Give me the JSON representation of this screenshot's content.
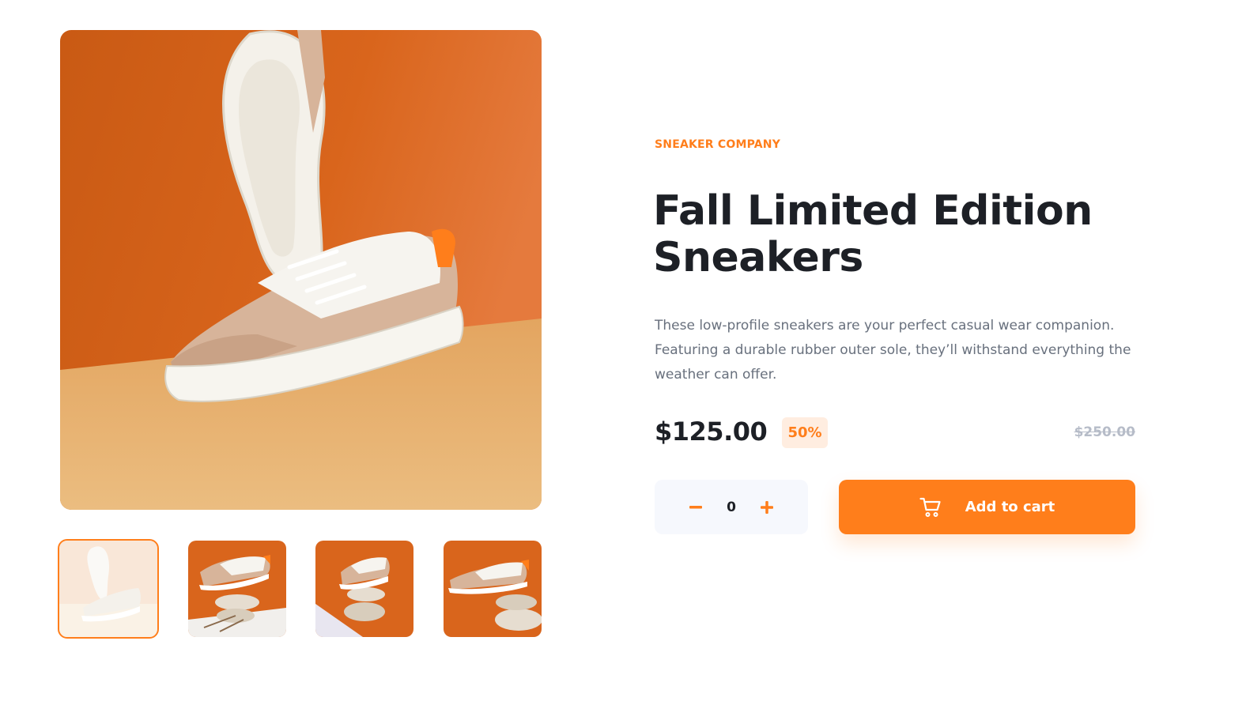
{
  "gallery": {
    "main_image_alt": "Fall Limited Edition Sneakers",
    "thumbnails": [
      {
        "alt": "Product thumbnail 1",
        "active": true
      },
      {
        "alt": "Product thumbnail 2",
        "active": false
      },
      {
        "alt": "Product thumbnail 3",
        "active": false
      },
      {
        "alt": "Product thumbnail 4",
        "active": false
      }
    ]
  },
  "product": {
    "company": "SNEAKER COMPANY",
    "title": "Fall Limited Edition Sneakers",
    "description": "These low-profile sneakers are your perfect casual wear companion. Featuring a durable rubber outer sole, they’ll withstand everything the weather can offer.",
    "price": "$125.00",
    "discount": "50%",
    "original_price": "$250.00"
  },
  "quantity": {
    "value": "0",
    "decrement_icon": "minus-icon",
    "increment_icon": "plus-icon"
  },
  "cart": {
    "button_label": "Add to cart",
    "icon": "cart-icon"
  },
  "colors": {
    "accent": "#ff7e1b",
    "accent_pale": "#ffede0",
    "text_dark": "#1d2026",
    "text_gray": "#68707d",
    "text_light": "#b6bcc8",
    "stepper_bg": "#f6f8fd"
  }
}
